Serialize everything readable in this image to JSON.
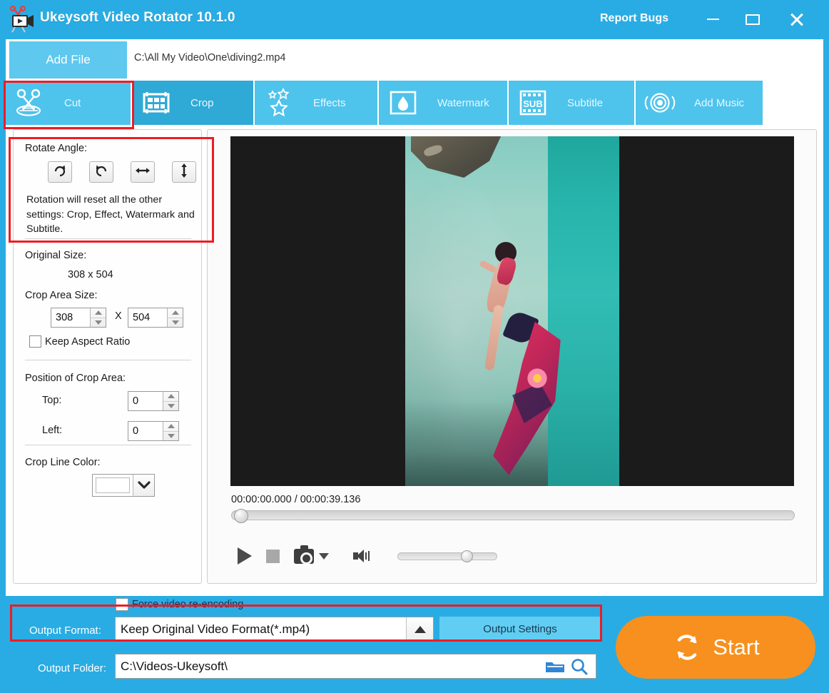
{
  "window": {
    "title": "Ukeysoft Video Rotator 10.1.0",
    "report_bugs": "Report Bugs",
    "accent_blue": "#29ace3",
    "tab_blue": "#4ec3ec",
    "tab_hot_blue": "#2fa9d6",
    "orange": "#f7901e",
    "annotation_red": "#ee1c25"
  },
  "toolbar": {
    "add_file_label": "Add File",
    "file_path": "C:\\All My Video\\One\\diving2.mp4"
  },
  "tabs": [
    {
      "id": "cut",
      "label": "Cut",
      "icon": "scissors-film-icon",
      "state": "selected"
    },
    {
      "id": "crop",
      "label": "Crop",
      "icon": "crop-grid-icon",
      "state": "hover"
    },
    {
      "id": "effects",
      "label": "Effects",
      "icon": "stars-icon",
      "state": "normal"
    },
    {
      "id": "watermark",
      "label": "Watermark",
      "icon": "water-drop-icon",
      "state": "normal"
    },
    {
      "id": "subtitle",
      "label": "Subtitle",
      "icon": "sub-film-icon",
      "state": "normal"
    },
    {
      "id": "addmusic",
      "label": "Add Music",
      "icon": "speaker-rings-icon",
      "state": "normal"
    }
  ],
  "left_panel": {
    "rotate_angle_label": "Rotate Angle:",
    "rotate_buttons": [
      {
        "id": "rotate-right",
        "icon": "rotate-clockwise-icon"
      },
      {
        "id": "rotate-left",
        "icon": "rotate-counterclockwise-icon"
      },
      {
        "id": "flip-horizontal",
        "icon": "flip-horizontal-icon"
      },
      {
        "id": "flip-vertical",
        "icon": "flip-vertical-icon"
      }
    ],
    "rotate_note": "Rotation will reset all the other settings: Crop, Effect, Watermark and Subtitle.",
    "original_size_label": "Original Size:",
    "original_size_value": "308 x 504",
    "crop_area_size_label": "Crop Area Size:",
    "crop_width": "308",
    "crop_x_separator": "X",
    "crop_height": "504",
    "keep_aspect_ratio_label": "Keep Aspect Ratio",
    "keep_aspect_ratio_checked": false,
    "position_label": "Position of Crop Area:",
    "top_label": "Top:",
    "top_value": "0",
    "left_label": "Left:",
    "left_value": "0",
    "crop_line_color_label": "Crop Line Color:",
    "crop_line_color_value": "#ffffff"
  },
  "player": {
    "time_readout": "00:00:00.000 / 00:00:39.136",
    "current_time": "00:00:00.000",
    "total_time": "00:00:39.136",
    "seek_position_percent": 0,
    "volume_percent": 63,
    "buttons": [
      {
        "id": "play",
        "icon": "play-icon"
      },
      {
        "id": "stop",
        "icon": "stop-icon"
      },
      {
        "id": "snapshot",
        "icon": "camera-icon"
      },
      {
        "id": "snapshot-menu",
        "icon": "chevron-down-icon"
      },
      {
        "id": "volume",
        "icon": "speaker-icon"
      }
    ]
  },
  "bottom": {
    "force_reencoding_label": "Force video re-encoding",
    "force_reencoding_checked": false,
    "output_format_label": "Output Format:",
    "output_format_value": "Keep Original Video Format(*.mp4)",
    "output_settings_label": "Output Settings",
    "output_folder_label": "Output Folder:",
    "output_folder_value": "C:\\Videos-Ukeysoft\\",
    "browse_icon": "folder-icon",
    "open_icon": "search-icon",
    "start_label": "Start",
    "start_icon": "refresh-cycle-icon"
  }
}
